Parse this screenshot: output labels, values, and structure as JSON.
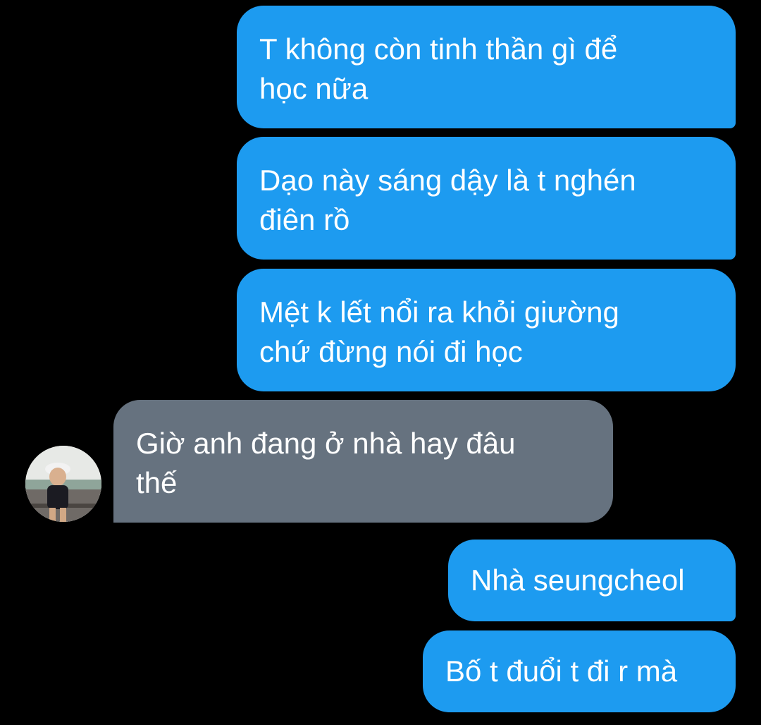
{
  "messages": [
    {
      "direction": "outgoing",
      "text": "T không còn tinh thần gì để\nhọc nữa"
    },
    {
      "direction": "outgoing",
      "text": "Dạo này sáng dậy là t nghén\nđiên rồ"
    },
    {
      "direction": "outgoing",
      "text": "Mệt k lết nổi ra khỏi giường\nchứ đừng nói đi học"
    },
    {
      "direction": "incoming",
      "text": "Giờ anh đang ở nhà hay đâu\nthế"
    },
    {
      "direction": "outgoing",
      "text": "Nhà seungcheol"
    },
    {
      "direction": "outgoing",
      "text": "Bố t đuổi t đi r mà"
    }
  ],
  "colors": {
    "background": "#000000",
    "outgoing_bubble": "#1d9bf0",
    "incoming_bubble": "#66727f",
    "text": "#ffffff"
  },
  "icons": {
    "avatar": "contact-avatar-photo"
  }
}
